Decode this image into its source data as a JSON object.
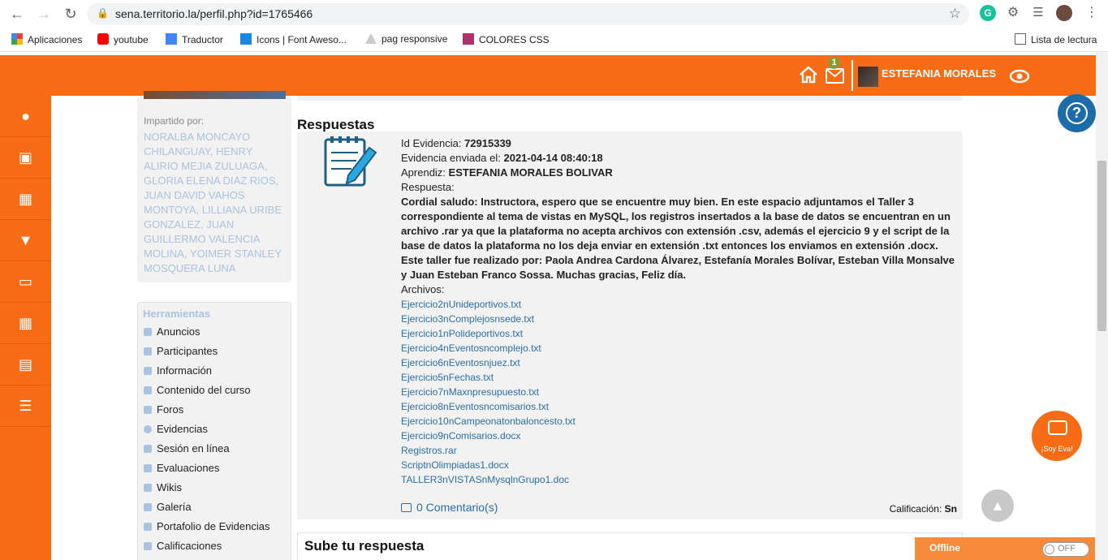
{
  "browser": {
    "url": "sena.territorio.la/perfil.php?id=1765466",
    "bookmarks": [
      "Aplicaciones",
      "youtube",
      "Traductor",
      "Icons | Font Aweso...",
      "pag responsive",
      "COLORES CSS"
    ],
    "reading_list": "Lista de lectura"
  },
  "header": {
    "notification_count": "1",
    "user_name": "ESTEFANIA MORALES"
  },
  "left": {
    "impartido_label": "Impartido por:",
    "instructors": "NORALBA MONCAYO CHILANGUAY, HENRY ALIRIO MEJIA ZULUAGA, GLORIA ELENA DIAZ RIOS, JUAN DAVID VAHOS MONTOYA, LILLIANA URIBE GONZALEZ, JUAN GUILLERMO VALENCIA MOLINA, YOIMER STANLEY MOSQUERA LUNA",
    "herramientas_title": "Herramientas",
    "tools": [
      "Anuncios",
      "Participantes",
      "Información",
      "Contenido del curso",
      "Foros",
      "Evidencias",
      "Sesión en línea",
      "Evaluaciones",
      "Wikis",
      "Galería",
      "Portafolio de Evidencias",
      "Calificaciones"
    ]
  },
  "main": {
    "title": "Respuestas",
    "id_label": "Id Evidencia:",
    "id_value": "72915339",
    "sent_label": "Evidencia enviada el:",
    "sent_value": "2021-04-14 08:40:18",
    "learner_label": "Aprendiz:",
    "learner_value": "ESTEFANIA MORALES BOLIVAR",
    "answer_label": "Respuesta:",
    "answer_text": "Cordial saludo: Instructora, espero que se encuentre muy bien. En este espacio adjuntamos el Taller 3 correspondiente al tema de vistas en MySQL, los registros insertados a la base de datos se encuentran en un archivo .rar ya que la plataforma no acepta archivos con extensión .csv, además el ejercicio 9 y el script de la base de datos la plataforma no los deja enviar en extensión .txt entonces los enviamos en extensión .docx. Este taller fue realizado por: Paola Andrea Cardona Álvarez, Estefanía Morales Bolívar, Esteban Villa Monsalve y Juan Esteban Franco Sossa. Muchas gracias, Feliz día.",
    "files_label": "Archivos:",
    "files": [
      "Ejercicio2nUnideportivos.txt",
      "Ejercicio3nComplejosnsede.txt",
      "Ejercicio1nPolideportivos.txt",
      "Ejercicio4nEventosncomplejo.txt",
      "Ejercicio6nEventosnjuez.txt",
      "Ejercicio5nFechas.txt",
      "Ejercicio7nMaxnpresupuesto.txt",
      "Ejercicio8nEventosncomisarios.txt",
      "Ejercicio10nCampeonatonbaloncesto.txt",
      "Ejercicio9nComisarios.docx",
      "Registros.rar",
      "ScriptnOlimpiadas1.docx",
      "TALLER3nVISTASnMysqlnGrupo1.doc"
    ],
    "comments": "0 Comentario(s)",
    "grade_label": "Calificación:",
    "grade_value": "Sn",
    "upload_title": "Sube tu respuesta"
  },
  "widgets": {
    "eva": "¡Soy Eva!",
    "offline": "Offline",
    "toggle": "OFF"
  }
}
